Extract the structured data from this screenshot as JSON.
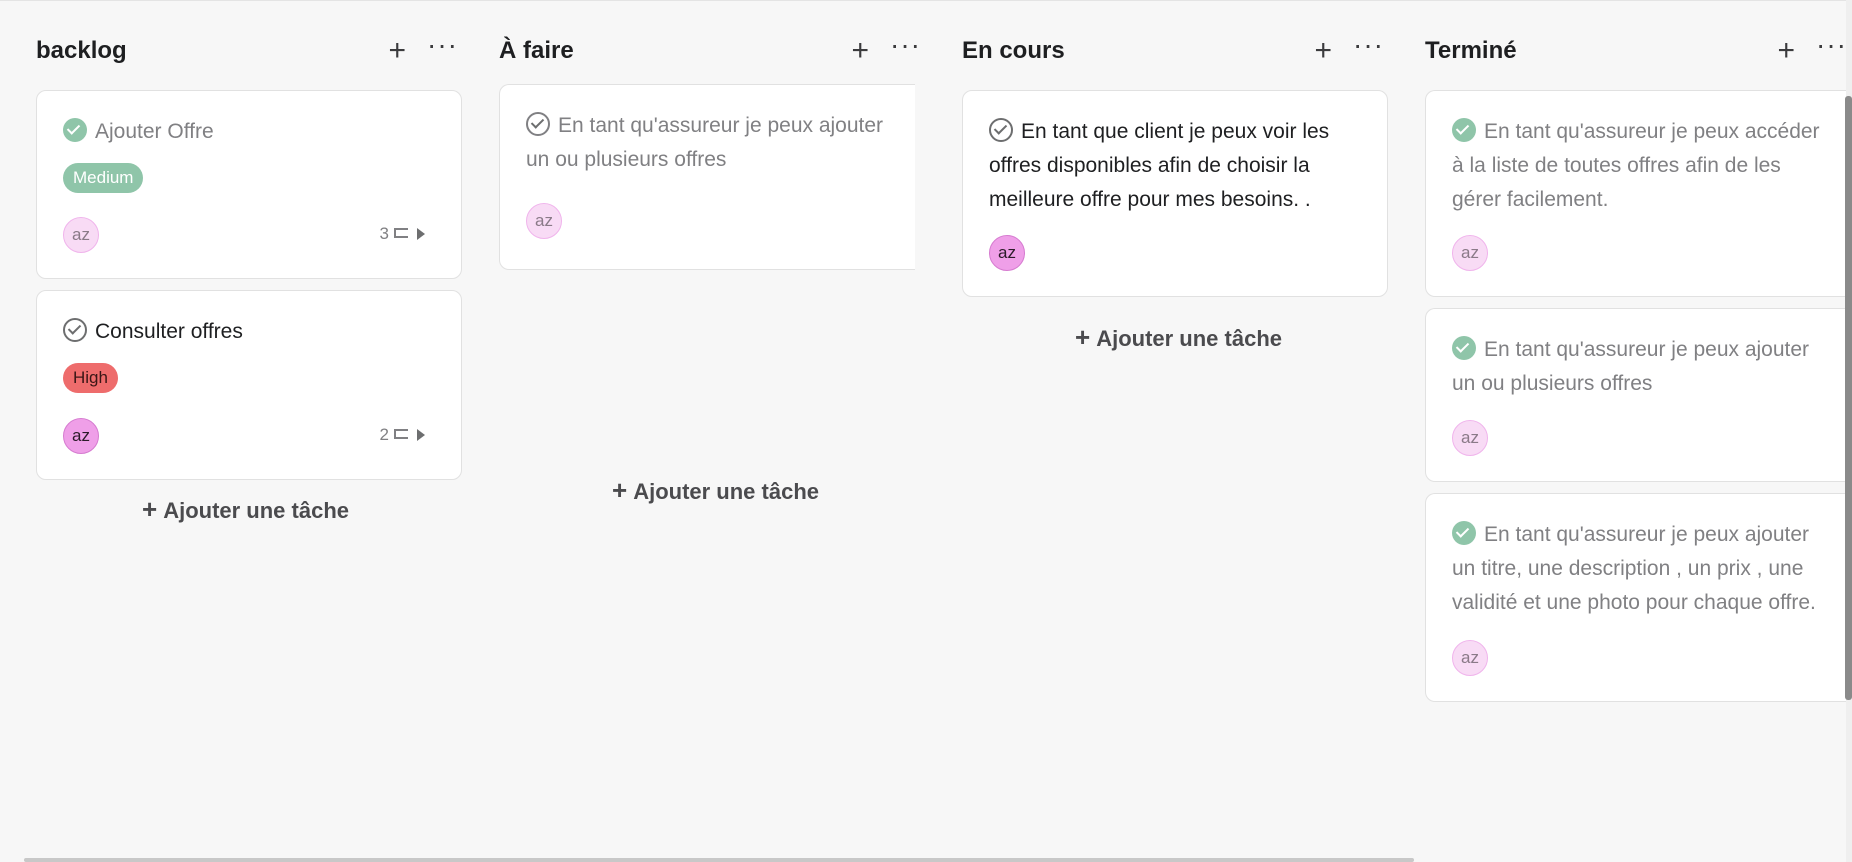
{
  "columns": [
    {
      "title": "backlog",
      "add_label": "+",
      "more_label": "···",
      "add_task_label": "Ajouter une tâche",
      "cards": [
        {
          "title": "Ajouter Offre",
          "completed": true,
          "priority": "Medium",
          "assignee": "az",
          "subtask_count": "3"
        },
        {
          "title": "Consulter offres",
          "completed": false,
          "priority": "High",
          "assignee": "az",
          "subtask_count": "2"
        }
      ]
    },
    {
      "title": "À faire",
      "add_label": "+",
      "more_label": "···",
      "add_task_label": "Ajouter une tâche",
      "cards": [
        {
          "title": "En tant qu'assureur je peux ajouter un ou plusieurs offres",
          "completed": false,
          "assignee": "az"
        }
      ]
    },
    {
      "title": "En cours",
      "add_label": "+",
      "more_label": "···",
      "add_task_label": "Ajouter une tâche",
      "cards": [
        {
          "title": "En tant que client je peux voir les offres disponibles afin de choisir la meilleure offre pour mes besoins. .",
          "completed": false,
          "assignee": "az"
        }
      ]
    },
    {
      "title": "Terminé",
      "add_label": "+",
      "more_label": "···",
      "cards": [
        {
          "title": "En tant qu'assureur je peux accéder à la liste de toutes offres afin de les gérer facilement.",
          "completed": true,
          "assignee": "az"
        },
        {
          "title": "En tant qu'assureur je peux ajouter un ou plusieurs offres",
          "completed": true,
          "assignee": "az"
        },
        {
          "title": "En tant qu'assureur je peux ajouter un titre, une description , un prix , une validité et une photo pour chaque offre.",
          "completed": true,
          "assignee": "az"
        }
      ]
    }
  ],
  "colors": {
    "completed_check": "#8fc5a9",
    "priority_medium": "#8fc5a9",
    "priority_high": "#ee6c6c",
    "avatar": "#f8dbf5"
  }
}
